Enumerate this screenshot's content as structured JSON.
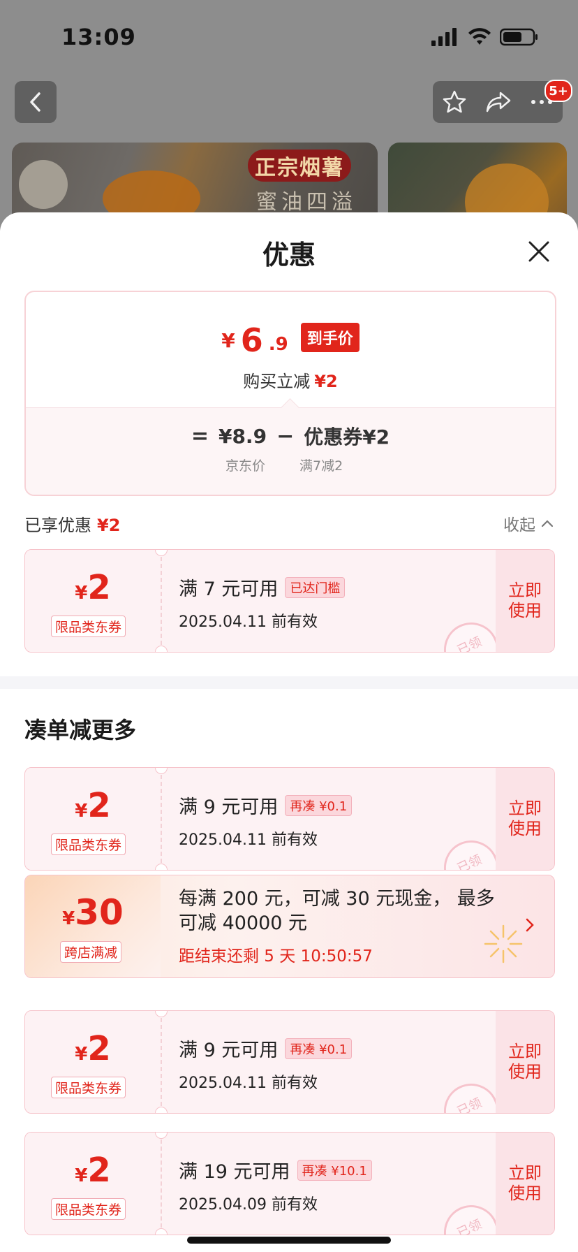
{
  "status_bar": {
    "time": "13:09"
  },
  "background_page": {
    "banner_tag": "正宗烟薯",
    "banner_sub": "蜜油四溢",
    "more_badge": "5+"
  },
  "sheet": {
    "title": "优惠",
    "price": {
      "yen": "¥",
      "integer": "6",
      "decimal": ".9",
      "tag": "到手价",
      "sub_text": "购买立减",
      "sub_amount": "¥2",
      "formula": {
        "equals": "=",
        "jd_price": "¥8.9",
        "minus": "−",
        "coupon": "优惠券¥2",
        "jd_price_label": "京东价",
        "coupon_label": "满7减2"
      }
    },
    "enjoyed": {
      "label": "已享优惠",
      "amount": "¥2",
      "collapse": "收起"
    },
    "applied_coupons": [
      {
        "yen": "¥",
        "amount": "2",
        "type": "限品类东券",
        "condition": "满 7 元可用",
        "pill": "已达门槛",
        "valid": "2025.04.11 前有效",
        "action_line1": "立即",
        "action_line2": "使用",
        "stamp": "已领"
      }
    ],
    "more_section_title": "凑单减更多",
    "more_coupons": [
      {
        "yen": "¥",
        "amount": "2",
        "type": "限品类东券",
        "condition": "满 9 元可用",
        "pill": "再凑 ¥0.1",
        "valid": "2025.04.11 前有效",
        "action_line1": "立即",
        "action_line2": "使用",
        "stamp": "已领"
      },
      {
        "yen": "¥",
        "amount": "2",
        "type": "限品类东券",
        "condition": "满 9 元可用",
        "pill": "再凑 ¥0.1",
        "valid": "2025.04.11 前有效",
        "action_line1": "立即",
        "action_line2": "使用",
        "stamp": "已领"
      },
      {
        "yen": "¥",
        "amount": "2",
        "type": "限品类东券",
        "condition": "满 19 元可用",
        "pill": "再凑 ¥10.1",
        "valid": "2025.04.09 前有效",
        "action_line1": "立即",
        "action_line2": "使用",
        "stamp": "已领"
      }
    ],
    "promo": {
      "yen": "¥",
      "amount": "30",
      "type": "跨店满减",
      "description": "每满 200 元，可减 30 元现金， 最多可减 40000 元",
      "countdown": "距结束还剩 5 天 10:50:57"
    }
  },
  "colors": {
    "accent": "#e1251b",
    "coupon_bg": "#fdf2f4",
    "coupon_border": "#f6c3ca"
  }
}
